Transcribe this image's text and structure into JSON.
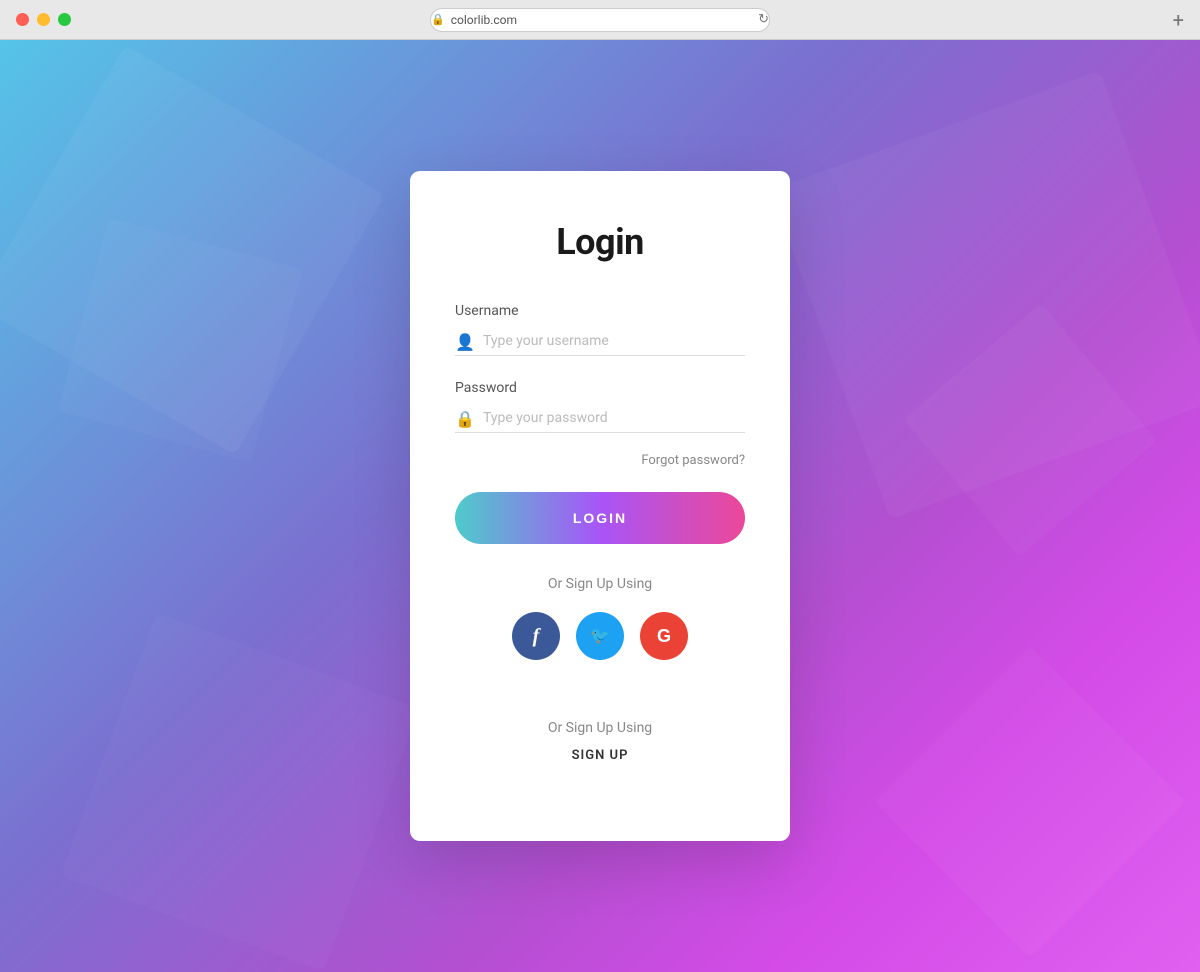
{
  "browser": {
    "url": "colorlib.com",
    "traffic_lights": {
      "close": "close",
      "minimize": "minimize",
      "maximize": "maximize"
    }
  },
  "form": {
    "title": "Login",
    "username_label": "Username",
    "username_placeholder": "Type your username",
    "password_label": "Password",
    "password_placeholder": "Type your password",
    "forgot_password": "Forgot password?",
    "login_button": "LOGIN",
    "or_sign_up_using": "Or Sign Up Using",
    "sign_up_link": "SIGN UP",
    "or_sign_up_using_2": "Or Sign Up Using"
  },
  "social": {
    "facebook_label": "f",
    "twitter_label": "t",
    "google_label": "G"
  }
}
